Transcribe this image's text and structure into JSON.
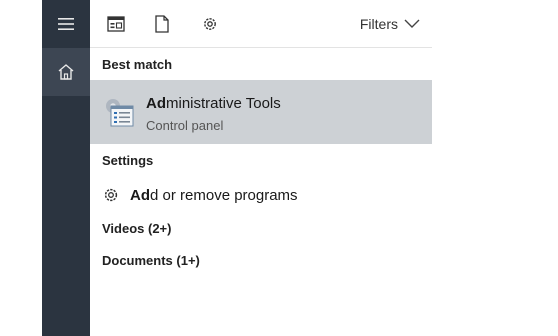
{
  "rail": {
    "menu_icon": "hamburger-icon",
    "home_icon": "home-icon"
  },
  "topbar": {
    "icons": [
      "apps-icon",
      "documents-icon",
      "settings-icon"
    ],
    "filters_label": "Filters",
    "filters_icon": "chevron-down-icon"
  },
  "best_match": {
    "heading": "Best match",
    "title_bold": "Ad",
    "title_rest": "ministrative Tools",
    "subtitle": "Control panel",
    "icon": "administrative-tools-icon"
  },
  "settings": {
    "heading": "Settings",
    "item_bold": "Ad",
    "item_rest": "d or remove programs",
    "item_icon": "gear-icon"
  },
  "groups": {
    "videos": "Videos (2+)",
    "documents": "Documents (1+)"
  },
  "colors": {
    "rail": "#2b3440",
    "rail_active": "#3d4653",
    "selected_row": "#cdd1d5"
  }
}
